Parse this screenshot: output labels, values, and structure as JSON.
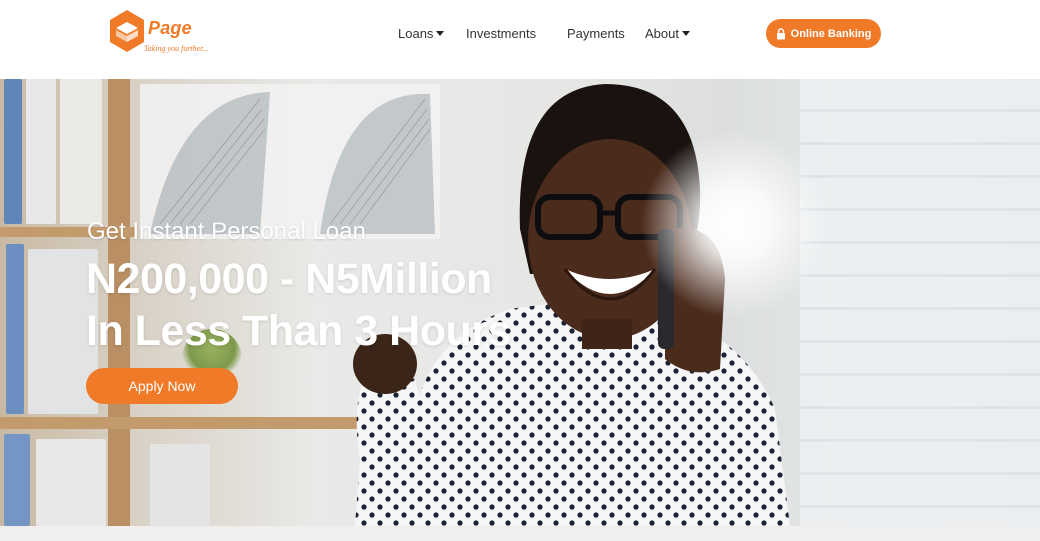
{
  "brand": {
    "name": "Page",
    "tagline": "Taking you further...",
    "color": "#f07a28"
  },
  "nav": {
    "items": [
      {
        "label": "Loans",
        "dropdown": true
      },
      {
        "label": "Investments",
        "dropdown": false
      },
      {
        "label": "Payments",
        "dropdown": false
      },
      {
        "label": "About",
        "dropdown": true
      }
    ],
    "online_banking": {
      "label": "Online Banking",
      "icon": "lock-icon"
    }
  },
  "hero": {
    "subtitle": "Get Instant Personal Loan",
    "headline_1": "N200,000 - N5Million",
    "headline_2": "In Less Than 3 Hours",
    "cta": "Apply Now"
  },
  "colors": {
    "accent": "#f07a28",
    "nav_text": "#333333",
    "hero_text": "#ffffff"
  }
}
